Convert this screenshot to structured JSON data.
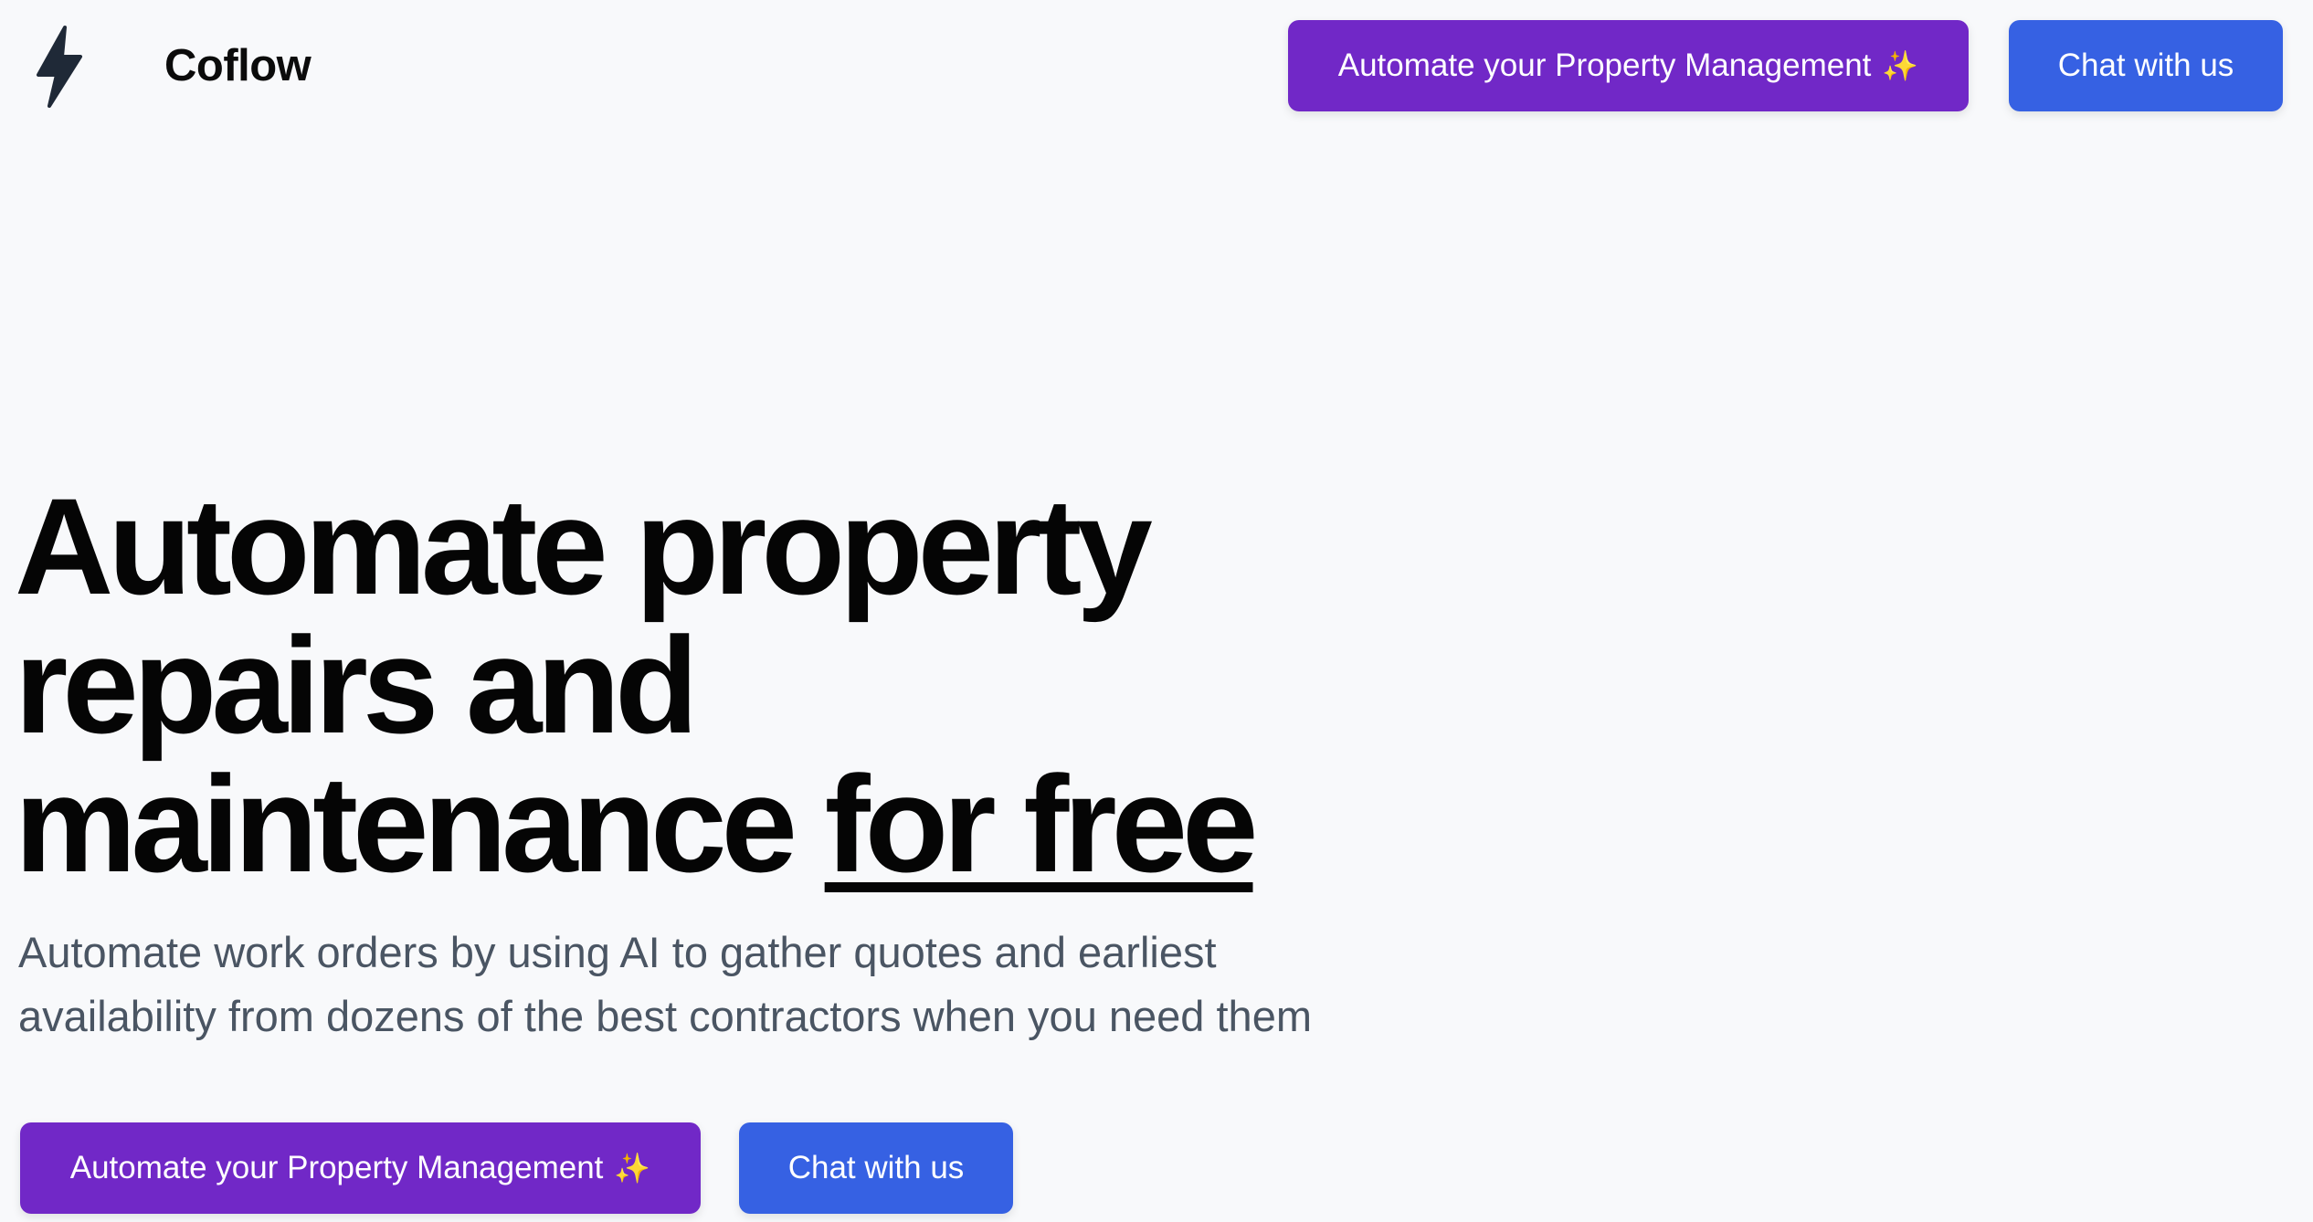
{
  "header": {
    "brand_name": "Coflow",
    "logo_icon": "lightning-bolt-icon",
    "automate_button_label": "Automate your Property Management",
    "automate_button_emoji": "✨",
    "chat_button_label": "Chat with us"
  },
  "hero": {
    "headline_line1": "Automate property",
    "headline_line2": "repairs and",
    "headline_line3_prefix": "maintenance ",
    "headline_line3_emphasis": "for free",
    "subtitle": "Automate work orders by using AI to gather quotes and earliest availability from dozens of the best contractors when you need them",
    "automate_button_label": "Automate your Property Management",
    "automate_button_emoji": "✨",
    "chat_button_label": "Chat with us"
  },
  "colors": {
    "background": "#f8f9fb",
    "purple_button": "#7128c7",
    "blue_button": "#3661e3",
    "subtitle_text": "#4a5563",
    "logo": "#1f2937"
  }
}
